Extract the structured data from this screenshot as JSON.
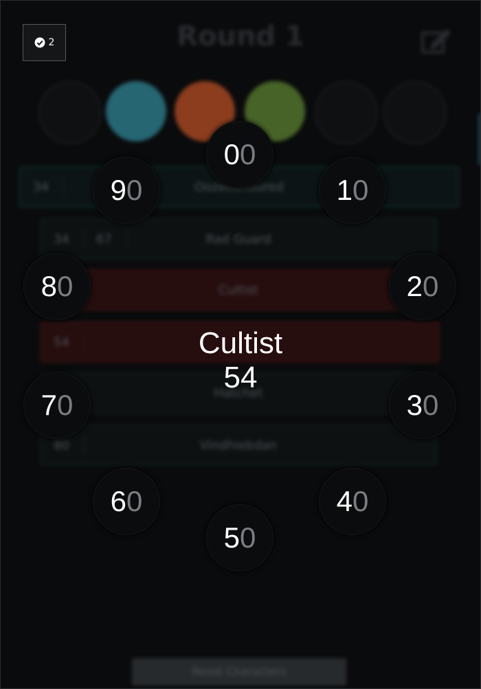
{
  "header": {
    "round_title": "Round 1",
    "badge_count": "2"
  },
  "elements": [
    {
      "name": "fire-element",
      "color": "#9a4320"
    },
    {
      "name": "air-element",
      "color": "#2a6f7e"
    },
    {
      "name": "earth-element",
      "color": "#4e6d2a"
    }
  ],
  "monster_rows": [
    {
      "c1": "34",
      "c2": "",
      "name": "Oozeballoured"
    },
    {
      "c1": "34",
      "c2": "67",
      "name": "Rad Guard"
    },
    {
      "c1": "",
      "c2": "",
      "name": "Cultist"
    },
    {
      "c1": "54",
      "c2": "",
      "name": ""
    },
    {
      "c1": "",
      "c2": "",
      "name": "Hatchet"
    },
    {
      "c1": "80",
      "c2": "",
      "name": "Vindhiebdan"
    }
  ],
  "dial": {
    "digits": [
      {
        "tens": "0",
        "ones": "0"
      },
      {
        "tens": "1",
        "ones": "0"
      },
      {
        "tens": "2",
        "ones": "0"
      },
      {
        "tens": "3",
        "ones": "0"
      },
      {
        "tens": "4",
        "ones": "0"
      },
      {
        "tens": "5",
        "ones": "0"
      },
      {
        "tens": "6",
        "ones": "0"
      },
      {
        "tens": "7",
        "ones": "0"
      },
      {
        "tens": "8",
        "ones": "0"
      },
      {
        "tens": "9",
        "ones": "0"
      }
    ],
    "selected_name": "Cultist",
    "selected_value": "54"
  },
  "footer": {
    "button_label": "Reset Characters"
  },
  "colors": {
    "background": "#0a0b0c",
    "accent_teal": "#2b6c7c",
    "row_red": "#2a0e0f"
  }
}
